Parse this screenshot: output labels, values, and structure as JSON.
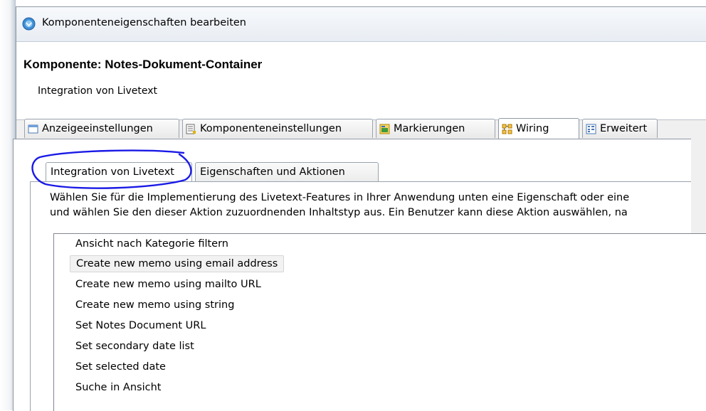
{
  "window": {
    "title": "Komponenteneigenschaften bearbeiten",
    "icon": "app-globe-icon"
  },
  "header": {
    "component_title": "Komponente: Notes-Dokument-Container",
    "subtitle": "Integration von Livetext"
  },
  "tabs": [
    {
      "label": "Anzeigeeinstellungen",
      "icon": "display-settings-icon",
      "active": false
    },
    {
      "label": "Komponenteneinstellungen",
      "icon": "component-settings-icon",
      "active": false
    },
    {
      "label": "Markierungen",
      "icon": "markings-icon",
      "active": false
    },
    {
      "label": "Wiring",
      "icon": "wiring-icon",
      "active": true
    },
    {
      "label": "Erweitert",
      "icon": "advanced-icon",
      "active": false
    }
  ],
  "subtabs": [
    {
      "label": "Integration von Livetext",
      "active": true
    },
    {
      "label": "Eigenschaften und Aktionen",
      "active": false
    }
  ],
  "description": {
    "line1": "Wählen Sie für die Implementierung des Livetext-Features in Ihrer Anwendung unten eine Eigenschaft oder eine",
    "line2": "und wählen Sie den dieser Aktion zuzuordnenden Inhaltstyp aus. Ein Benutzer kann diese Aktion auswählen, na"
  },
  "actions_list": {
    "items": [
      "Ansicht nach Kategorie filtern",
      "Create new memo using email address",
      "Create new memo using mailto URL",
      "Create new memo using string",
      "Set Notes Document URL",
      "Set secondary date list",
      "Set selected date",
      "Suche in Ansicht"
    ],
    "selected_index": 1
  },
  "annotation": {
    "color": "#1a1ae6"
  }
}
